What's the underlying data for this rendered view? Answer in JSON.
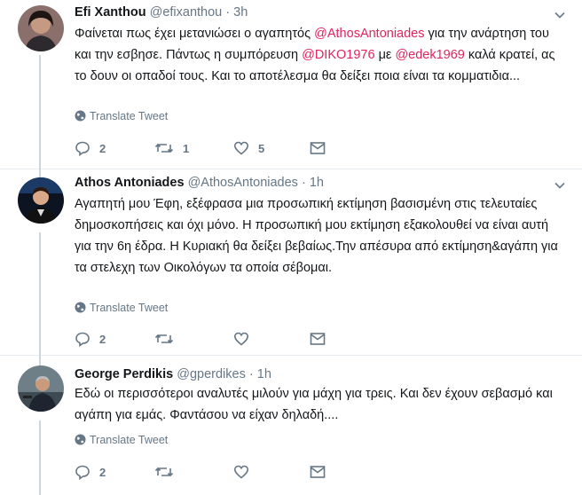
{
  "colors": {
    "mention": "#e0245e",
    "muted": "#657786",
    "thread_line": "#ccd6dd"
  },
  "tweets": [
    {
      "name": "Efi Xanthou",
      "handle": "@efixanthou",
      "dot": "·",
      "time": "3h",
      "text_parts": [
        {
          "t": "Φαίνεται πως έχει μετανιώσει ο αγαπητός ",
          "m": false
        },
        {
          "t": "@AthosAntoniades",
          "m": true
        },
        {
          "t": " για την ανάρτηση του και την εσβησε. Πάντως η συμπόρευση ",
          "m": false
        },
        {
          "t": "@DIKO1976",
          "m": true
        },
        {
          "t": " με ",
          "m": false
        },
        {
          "t": "@edek1969",
          "m": true
        },
        {
          "t": " καλά κρατεί, ας το δουν οι οπαδοί τους. Και το αποτέλεσμα θα δείξει ποια είναι τα κομματιδια...",
          "m": false
        }
      ],
      "translate": "Translate Tweet",
      "replies": "2",
      "retweets": "1",
      "likes": "5"
    },
    {
      "name": "Athos Antoniades",
      "handle": "@AthosAntoniades",
      "dot": "·",
      "time": "1h",
      "text_parts": [
        {
          "t": "Αγαπητή μου Έφη, εξέφρασα μια προσωπική εκτίμηση βασισμένη στις τελευταίες δημοσκοπήσεις και όχι μόνο. Η προσωπική μου εκτίμηση εξακολουθεί να είναι αυτή για την 6η έδρα. Η Κυριακή θα δείξει βεβαίως.Την απέσυρα από εκτίμηση&αγάπη για τα στελεχη των Οικολόγων τα οποία σέβομαι.",
          "m": false
        }
      ],
      "translate": "Translate Tweet",
      "replies": "2",
      "retweets": "",
      "likes": ""
    },
    {
      "name": "George Perdikis",
      "handle": "@gperdikes",
      "dot": "·",
      "time": "1h",
      "text_parts": [
        {
          "t": "Εδώ οι περισσότεροι αναλυτές μιλούν για μάχη για τρεις. Και δεν έχουν σεβασμό και αγάπη για εμάς. Φαντάσου να είχαν δηλαδή....",
          "m": false
        }
      ],
      "translate": "Translate Tweet",
      "replies": "2",
      "retweets": "",
      "likes": ""
    }
  ]
}
